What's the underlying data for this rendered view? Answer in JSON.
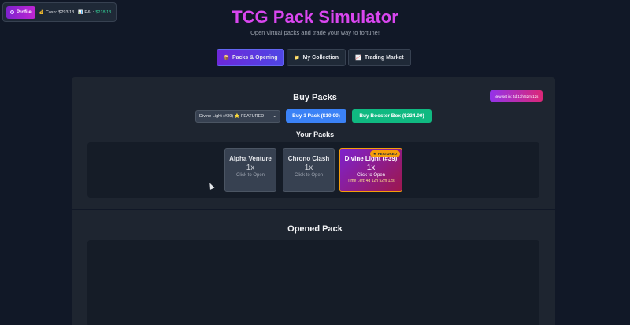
{
  "statusbar": {
    "profile_label": "Profile",
    "cash_label": "Cash:",
    "cash_value": "$293.13",
    "pnl_label": "P&L:",
    "pnl_value": "$218.13"
  },
  "header": {
    "title": "TCG Pack Simulator",
    "subtitle": "Open virtual packs and trade your way to fortune!"
  },
  "tabs": [
    {
      "icon": "📦",
      "label": "Packs & Opening"
    },
    {
      "icon": "📁",
      "label": "My Collection"
    },
    {
      "icon": "📈",
      "label": "Trading Market"
    }
  ],
  "timer_badge": "New set in: 4d 13h 52m 12s",
  "buy": {
    "heading": "Buy Packs",
    "selected_pack": "Divine Light (#39) ⭐ FEATURED",
    "buy_one_label": "Buy 1 Pack ($10.00)",
    "buy_box_label": "Buy Booster Box ($234.00)"
  },
  "your_packs": {
    "heading": "Your Packs",
    "packs": [
      {
        "name": "Alpha Venture",
        "count": "1x",
        "cta": "Click to Open"
      },
      {
        "name": "Chrono Clash",
        "count": "1x",
        "cta": "Click to Open"
      },
      {
        "name": "Divine Light (#39)",
        "count": "1x",
        "cta": "Click to Open",
        "time_left": "Time Left: 4d 12h 52m 12s",
        "tag": "FEATURED"
      }
    ]
  },
  "opened": {
    "heading": "Opened Pack"
  }
}
